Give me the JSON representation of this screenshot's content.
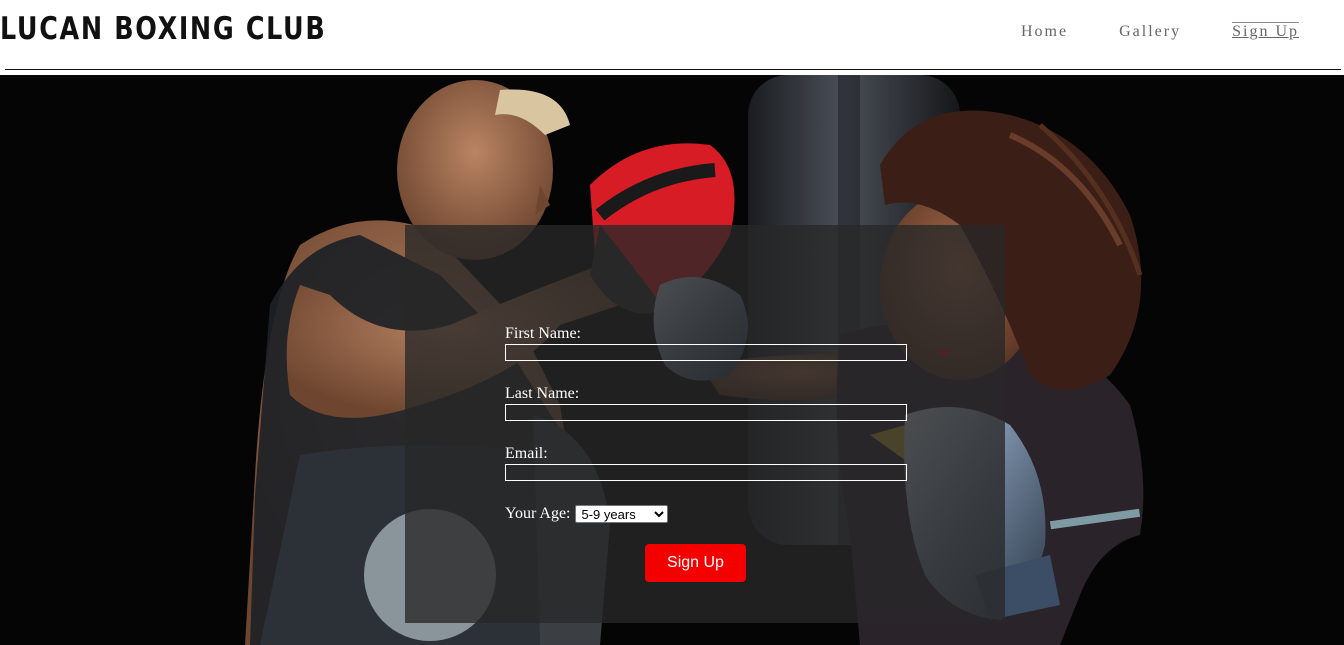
{
  "header": {
    "logo": "LUCAN BOXING CLUB",
    "nav": [
      {
        "label": "Home",
        "active": false
      },
      {
        "label": "Gallery",
        "active": false
      },
      {
        "label": "Sign Up",
        "active": true
      }
    ]
  },
  "form": {
    "first_name_label": "First Name:",
    "first_name_value": "",
    "last_name_label": "Last Name:",
    "last_name_value": "",
    "email_label": "Email:",
    "email_value": "",
    "age_label": "Your Age:",
    "age_selected": "5-9 years",
    "submit_label": "Sign Up"
  },
  "colors": {
    "accent": "#f40000",
    "hero_background": "#050505",
    "panel": "rgba(40,40,40,0.78)"
  }
}
